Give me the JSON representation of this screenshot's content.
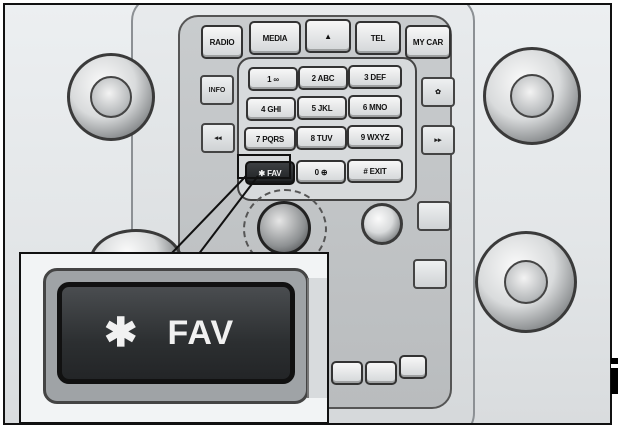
{
  "top_row": [
    "RADIO",
    "MEDIA",
    "▲",
    "TEL",
    "MY CAR"
  ],
  "side_left": [
    "INFO",
    "◂◂"
  ],
  "side_right": [
    "✿",
    "▸▸"
  ],
  "keypad": [
    [
      "1 ∞",
      "2 ABC",
      "3 DEF"
    ],
    [
      "4 GHI",
      "5 JKL",
      "6 MNO"
    ],
    [
      "7 PQRS",
      "8 TUV",
      "9 WXYZ"
    ],
    [
      "✱ FAV",
      "0 ⊕",
      "# EXIT"
    ]
  ],
  "callout": {
    "star": "✱",
    "label": "FAV"
  },
  "highlight_color": "#222426"
}
